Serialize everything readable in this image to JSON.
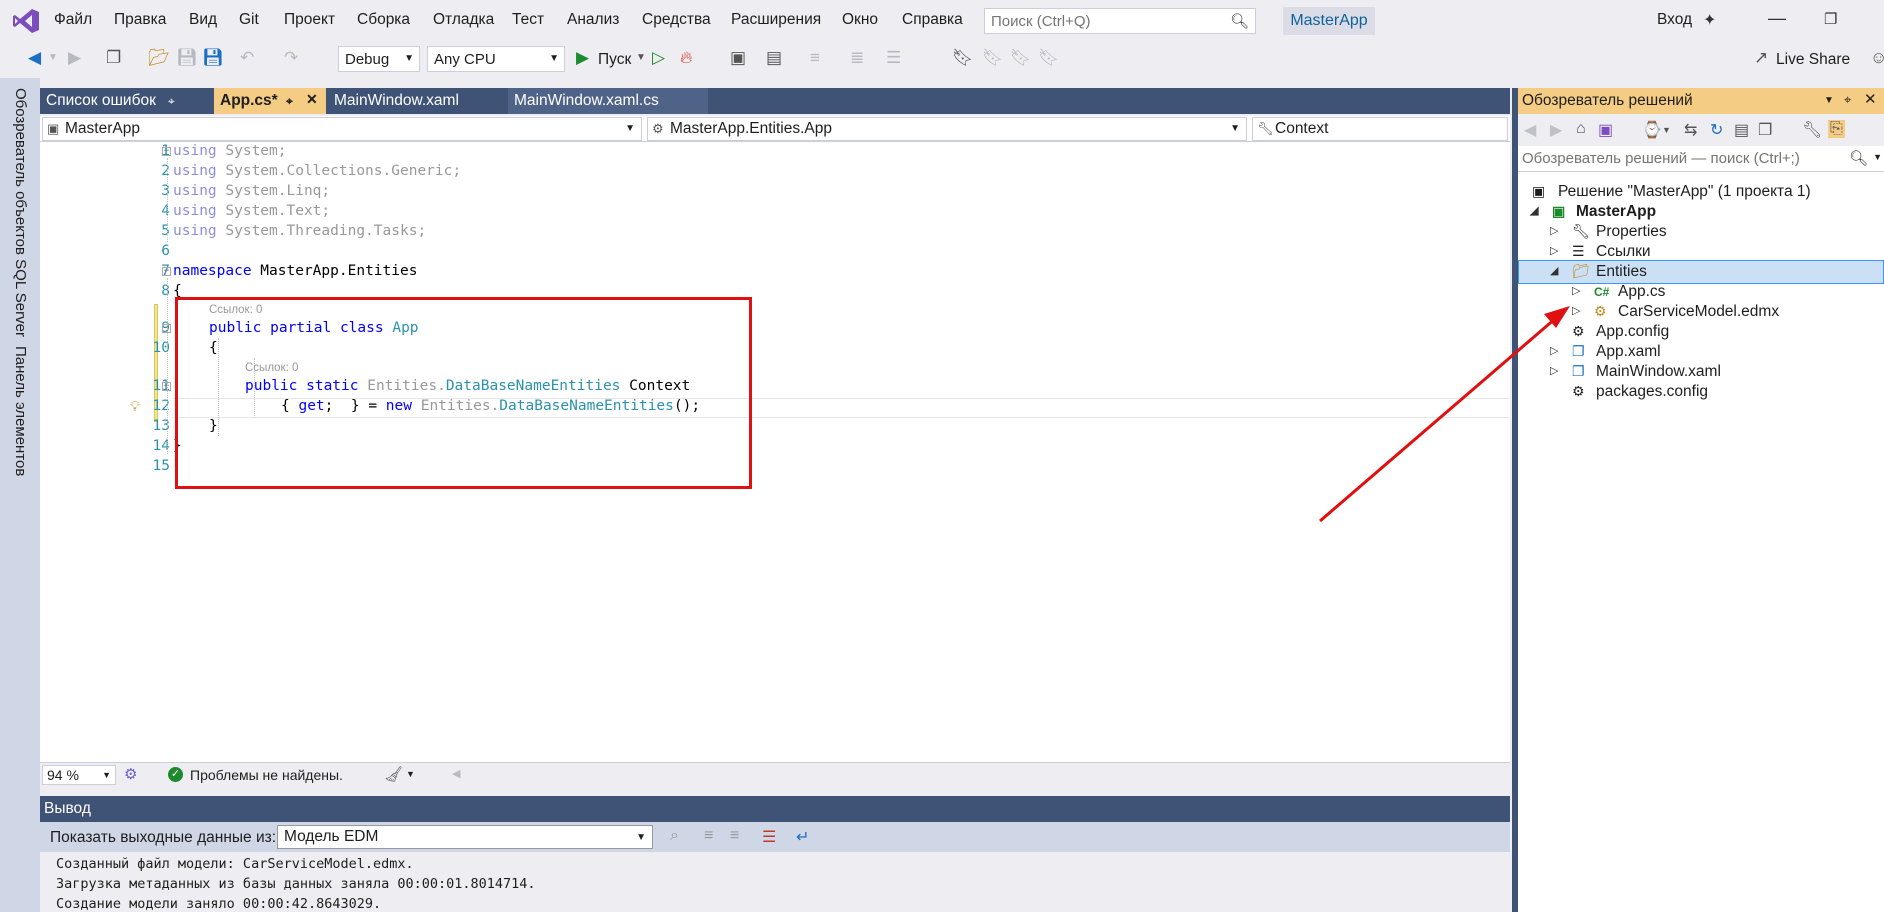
{
  "menu": {
    "items": [
      "Файл",
      "Правка",
      "Вид",
      "Git",
      "Проект",
      "Сборка",
      "Отладка",
      "Тест",
      "Анализ",
      "Средства",
      "Расширения",
      "Окно",
      "Справка"
    ],
    "search_placeholder": "Поиск (Ctrl+Q)",
    "app_name": "MasterApp",
    "sign_in": "Вход"
  },
  "toolbar": {
    "config": "Debug",
    "platform": "Any CPU",
    "start_label": "Пуск",
    "live_share": "Live Share"
  },
  "left_bar": {
    "tab_sql": "Обозреватель объектов SQL Server",
    "tab_toolbox": "Панель элементов"
  },
  "doc_tabs": [
    {
      "label": "Список ошибок"
    },
    {
      "label": "App.cs*"
    },
    {
      "label": "MainWindow.xaml"
    },
    {
      "label": "MainWindow.xaml.cs"
    }
  ],
  "nav_bar": {
    "project": "MasterApp",
    "type": "MasterApp.Entities.App",
    "member": "Context"
  },
  "code": {
    "line_numbers": [
      "1",
      "2",
      "3",
      "4",
      "5",
      "6",
      "7",
      "8",
      "9",
      "10",
      "11",
      "12",
      "13",
      "14",
      "15"
    ],
    "lens_ref": "Ссылок: 0",
    "using_kw": "using",
    "using1": " System;",
    "using2": " System.Collections.Generic;",
    "using3": " System.Linq;",
    "using4": " System.Text;",
    "using5": " System.Threading.Tasks;",
    "ns_kw": "namespace",
    "ns_name": " MasterApp.Entities",
    "brace_open": "{",
    "brace_close": "}",
    "class_kw": "public partial class",
    "class_name": "App",
    "prop_kw": "public static",
    "prop_ns": "Entities.",
    "prop_type": "DataBaseNameEntities",
    "prop_name": " Context",
    "acc_open": "{ ",
    "acc_get": "get",
    "acc_mid": ";  } = ",
    "acc_new": "new",
    "acc_end": "();"
  },
  "editor_status": {
    "zoom": "94 %",
    "issues": "Проблемы не найдены."
  },
  "output": {
    "title": "Вывод",
    "show_from_label": "Показать выходные данные из:",
    "source": "Модель EDM",
    "lines": [
      "Созданный файл модели: CarServiceModel.edmx.",
      "Загрузка метаданных из базы данных заняла 00:00:01.8014714.",
      "Создание модели заняло 00:00:42.8643029."
    ]
  },
  "solution_explorer": {
    "title": "Обозреватель решений",
    "search_placeholder": "Обозреватель решений — поиск (Ctrl+;)",
    "items": [
      {
        "label": "Решение \"MasterApp\"  (1 проекта 1)"
      },
      {
        "label": "MasterApp"
      },
      {
        "label": "Properties"
      },
      {
        "label": "Ссылки"
      },
      {
        "label": "Entities"
      },
      {
        "label": "App.cs"
      },
      {
        "label": "CarServiceModel.edmx"
      },
      {
        "label": "App.config"
      },
      {
        "label": "App.xaml"
      },
      {
        "label": "MainWindow.xaml"
      },
      {
        "label": "packages.config"
      }
    ]
  },
  "colors": {
    "accent_tab": "#f5cc84",
    "dark_tab": "#3f5376",
    "annotation_red": "#e01010",
    "selected_row": "#cce0f5"
  }
}
